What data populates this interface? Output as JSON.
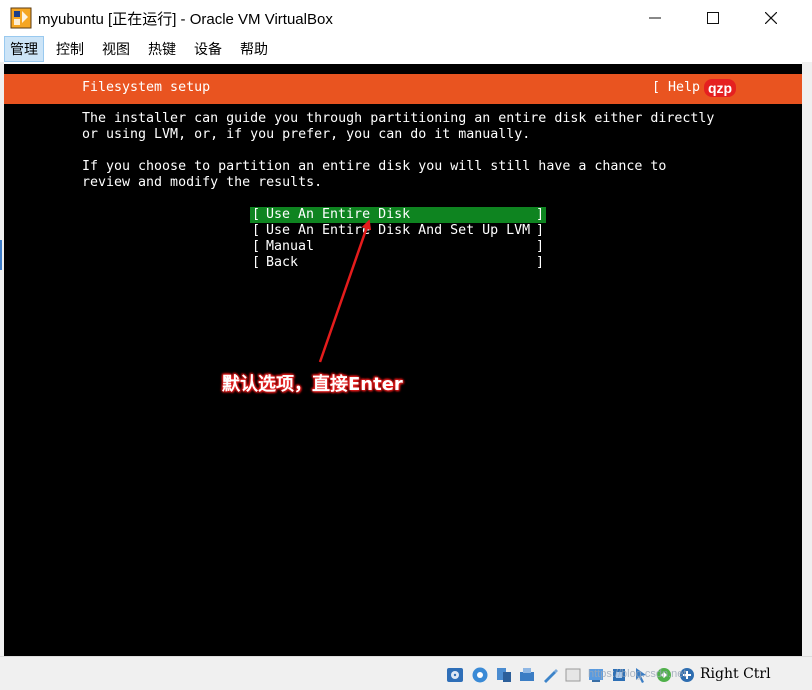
{
  "window": {
    "title": "myubuntu [正在运行] - Oracle VM VirtualBox",
    "controls": [
      "minimize",
      "maximize",
      "close"
    ]
  },
  "menubar": {
    "items": [
      "管理",
      "控制",
      "视图",
      "热键",
      "设备",
      "帮助"
    ],
    "active_index": 0
  },
  "installer": {
    "header": "Filesystem setup",
    "help": "[ Help ]",
    "paragraph1": [
      "The installer can guide you through partitioning an entire disk either directly",
      "or using LVM, or, if you prefer, you can do it manually."
    ],
    "paragraph2": [
      "If you choose to partition an entire disk you will still have a chance to",
      "review and modify the results."
    ],
    "options": [
      {
        "label": "Use An Entire Disk",
        "selected": true
      },
      {
        "label": "Use An Entire Disk And Set Up LVM",
        "selected": false
      },
      {
        "label": "Manual",
        "selected": false
      },
      {
        "label": "Back",
        "selected": false
      }
    ],
    "bracket_open": "[",
    "bracket_close": "]"
  },
  "watermark": "qzp",
  "annotation": "默认选项，直接Enter",
  "statusbar": {
    "host_key": "Right Ctrl",
    "site_watermark": "https://blog.csdn.net",
    "icons": [
      "optical-drive-icon",
      "audio-icon",
      "network-icon",
      "usb-icon",
      "shared-folder-icon",
      "display-icon",
      "recording-icon",
      "cpu-icon",
      "mouse-integration-icon",
      "keyboard-icon"
    ]
  },
  "colors": {
    "ubuntu_orange": "#e95420",
    "selection_green": "#0e8420",
    "annotation_red": "#e51c1c",
    "console_bg": "#000000"
  }
}
